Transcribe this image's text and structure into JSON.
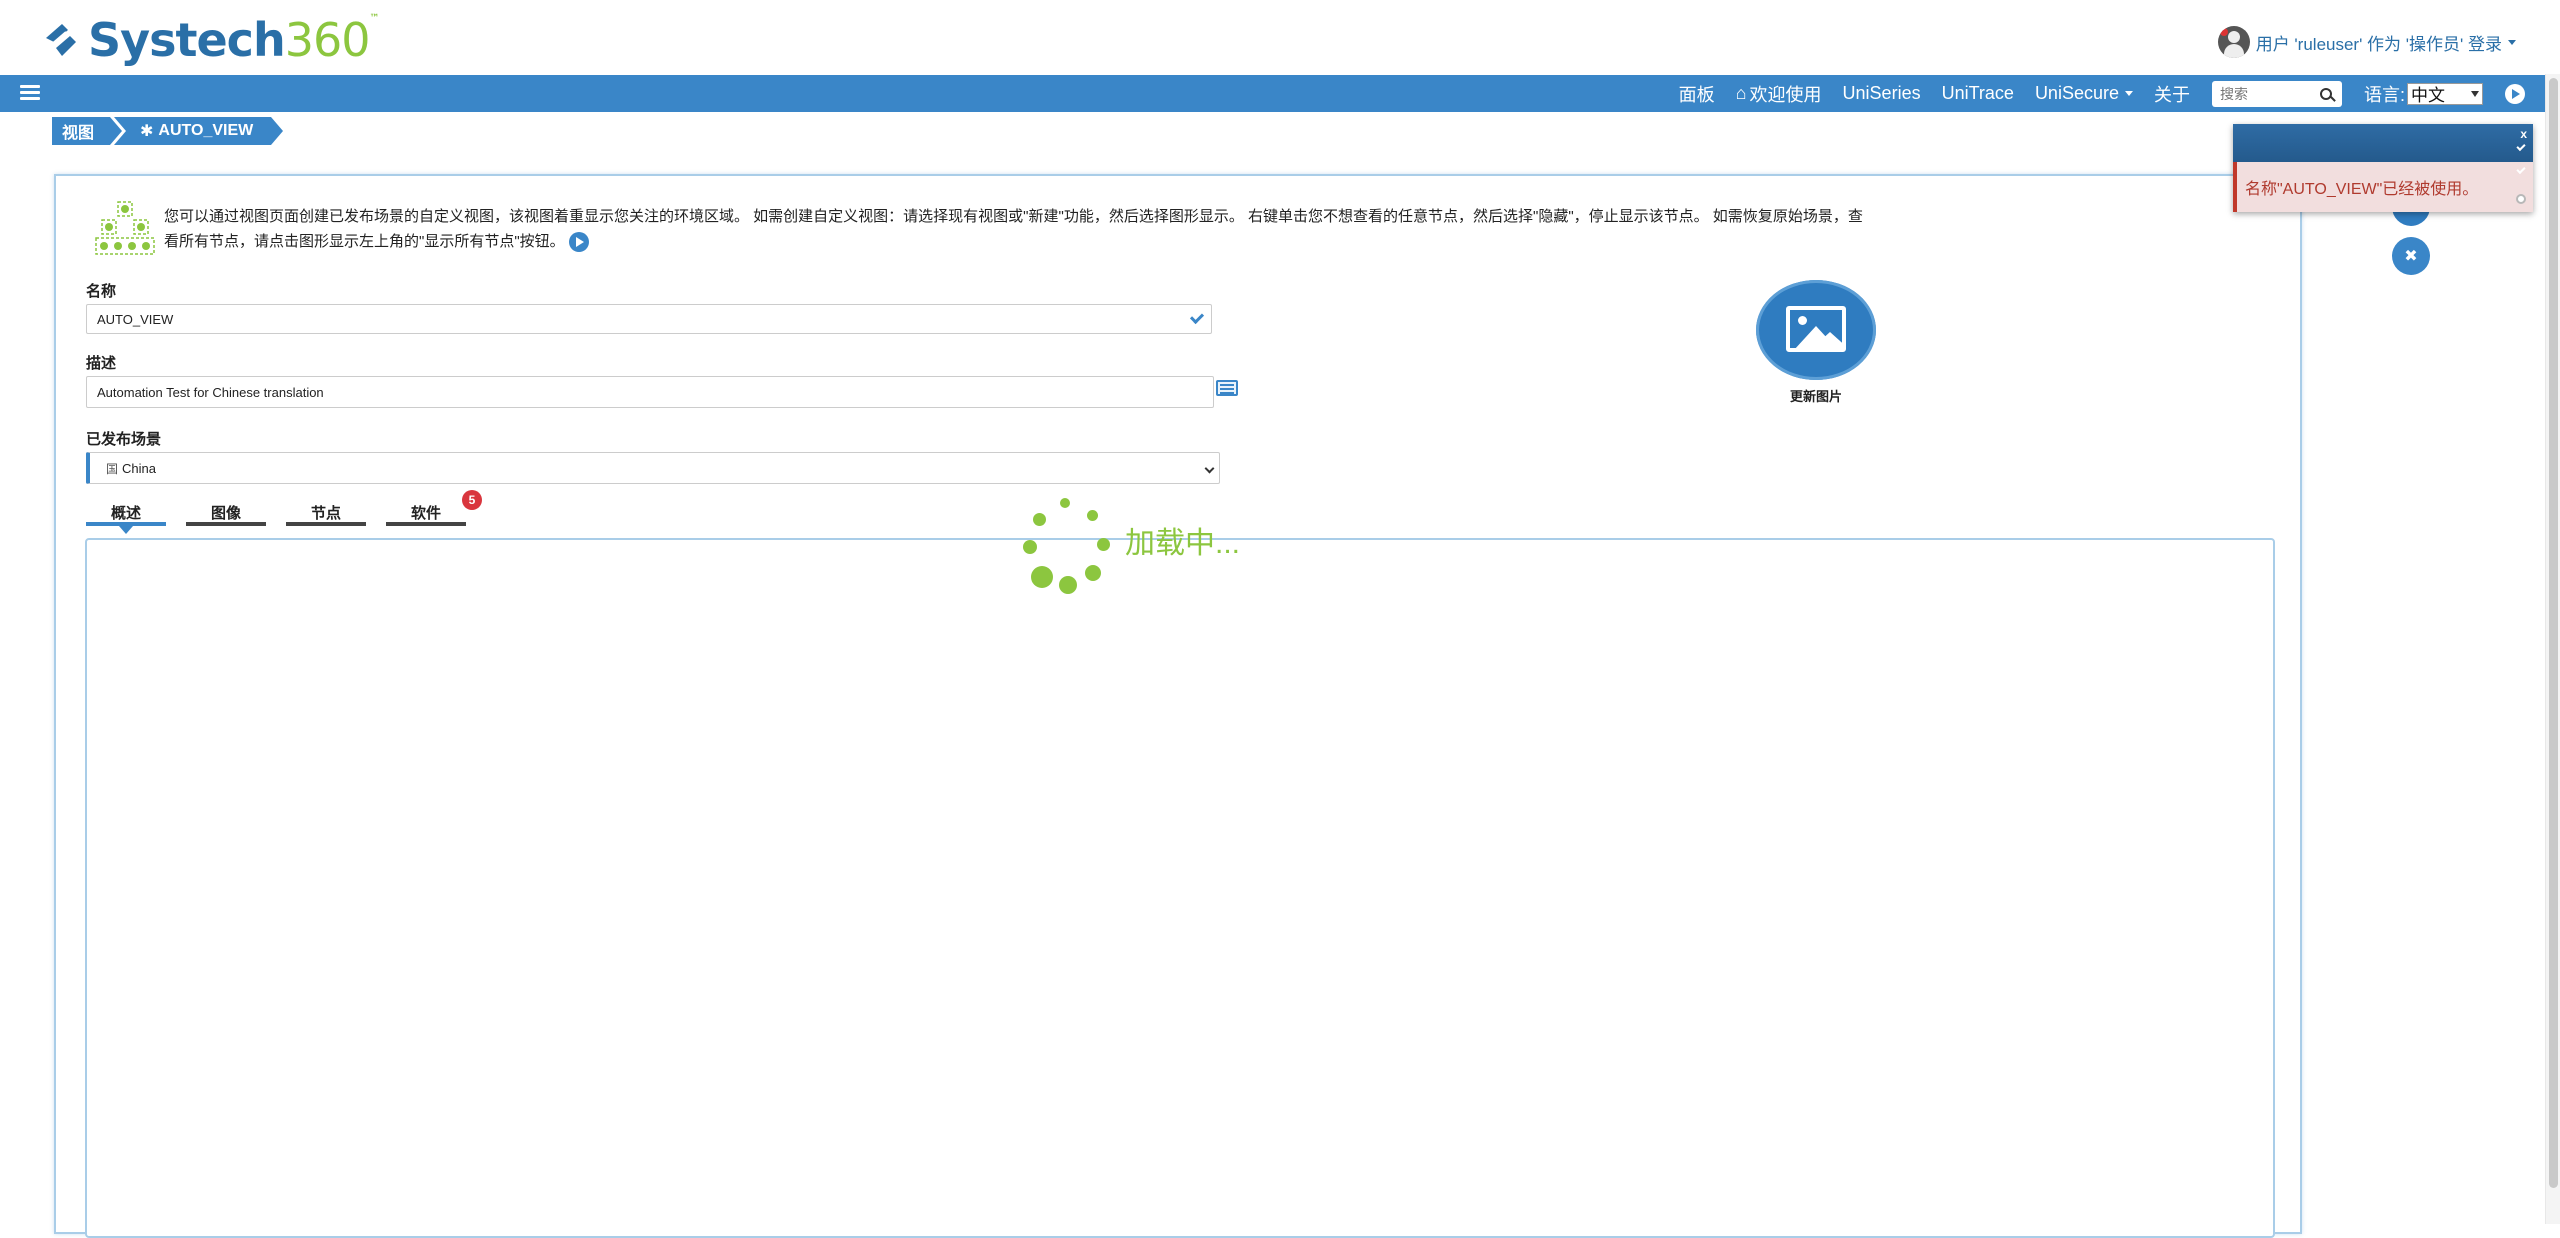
{
  "header": {
    "logo_name": "Systech",
    "logo_num": "360",
    "logo_tm": "™",
    "user_text": "用户 'ruleuser' 作为 '操作员' 登录"
  },
  "nav": {
    "items": [
      "面板",
      "欢迎使用",
      "UniSeries",
      "UniTrace",
      "UniSecure",
      "关于"
    ],
    "search_placeholder": "搜索",
    "lang_label": "语言:",
    "lang_value": "中文"
  },
  "breadcrumb": {
    "root": "视图",
    "current": "AUTO_VIEW"
  },
  "intro": {
    "text": "您可以通过视图页面创建已发布场景的自定义视图，该视图着重显示您关注的环境区域。 如需创建自定义视图：请选择现有视图或\"新建\"功能，然后选择图形显示。 右键单击您不想查看的任意节点，然后选择\"隐藏\"，停止显示该节点。 如需恢复原始场景，查看所有节点，请点击图形显示左上角的\"显示所有节点\"按钮。"
  },
  "form": {
    "name_label": "名称",
    "name_value": "AUTO_VIEW",
    "desc_label": "描述",
    "desc_value": "Automation Test for Chinese translation",
    "scene_label": "已发布场景",
    "scene_flag": "国",
    "scene_value": "China"
  },
  "picture": {
    "label": "更新图片"
  },
  "tabs": {
    "items": [
      "概述",
      "图像",
      "节点",
      "软件"
    ],
    "software_badge": "5",
    "active": 0
  },
  "loading": {
    "text": "加载中..."
  },
  "notification": {
    "close": "x",
    "message": "名称\"AUTO_VIEW\"已经被使用。"
  },
  "colors": {
    "primary": "#3a86c8",
    "accent_green": "#8cc63f",
    "error_red": "#b03a2e"
  }
}
